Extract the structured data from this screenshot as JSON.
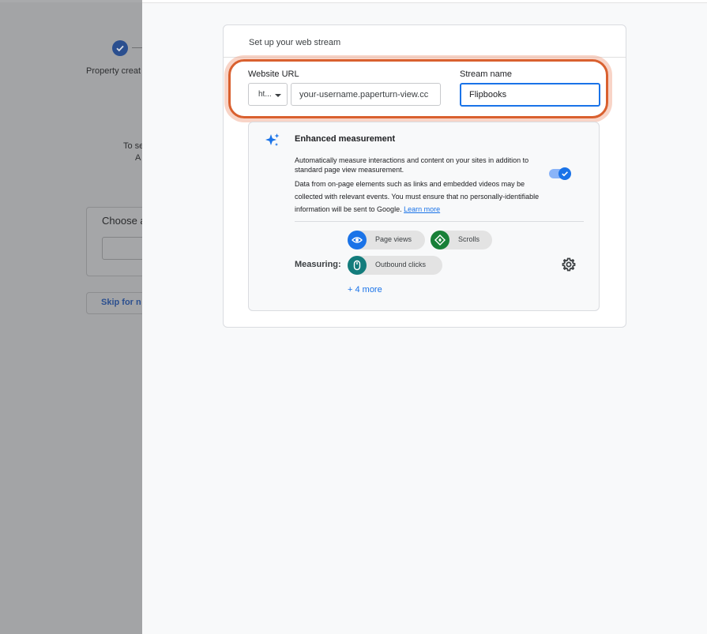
{
  "background": {
    "step_label": "Property creat",
    "text_line1": "To se",
    "text_line2": "A",
    "card_title": "Choose a",
    "skip_label": "Skip for n"
  },
  "stream_form": {
    "section_title": "Set up your web stream",
    "website_url_label": "Website URL",
    "protocol_value": "ht...",
    "url_value": "your-username.paperturn-view.cc",
    "stream_name_label": "Stream name",
    "stream_name_value": "Flipbooks"
  },
  "enhanced": {
    "title": "Enhanced measurement",
    "description": "Automatically measure interactions and content on your sites in addition to standard page view measurement.",
    "data_notice": "Data from on-page elements such as links and embedded videos may be collected with relevant events. You must ensure that no personally-identifiable information will be sent to Google.",
    "learn_more": "Learn more",
    "toggle_on": true,
    "measuring_label": "Measuring:",
    "chips": [
      {
        "label": "Page views",
        "icon": "eye-icon",
        "color": "#1a73e8"
      },
      {
        "label": "Scrolls",
        "icon": "scroll-diamond-icon",
        "color": "#188038"
      },
      {
        "label": "Outbound clicks",
        "icon": "mouse-icon",
        "color": "#137c7c"
      }
    ],
    "more_link": "+ 4 more"
  },
  "colors": {
    "accent": "#1a73e8",
    "highlight_ring": "#d9602f",
    "drawer_bg": "#f8f9fa"
  }
}
